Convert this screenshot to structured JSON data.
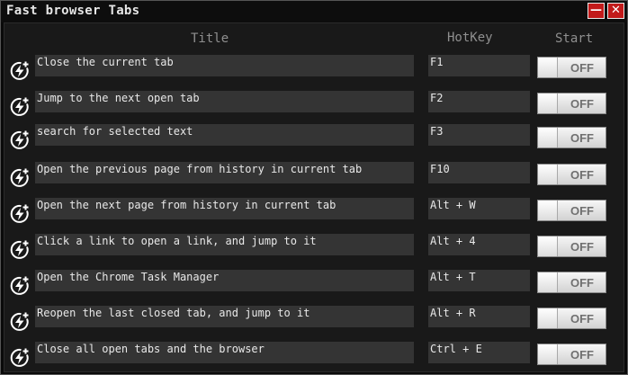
{
  "window": {
    "title": "Fast browser Tabs",
    "minimize_label": "—",
    "close_label": "✕"
  },
  "columns": {
    "title": "Title",
    "hotkey": "HotKey",
    "start": "Start"
  },
  "row_icon": "lightning-bolt-plus-icon",
  "rows": [
    {
      "task": "Close the current tab",
      "hotkey": "F1",
      "state": "OFF"
    },
    {
      "task": "Jump to the next open tab",
      "hotkey": "F2",
      "state": "OFF"
    },
    {
      "task": "search for selected text",
      "hotkey": "F3",
      "state": "OFF"
    },
    {
      "task": "Open the previous page from history in current tab",
      "hotkey": "F10",
      "state": "OFF"
    },
    {
      "task": "Open the next page from history in current tab",
      "hotkey": "Alt + W",
      "state": "OFF"
    },
    {
      "task": "Click a link to open a link, and jump to it",
      "hotkey": "Alt + 4",
      "state": "OFF"
    },
    {
      "task": "Open the Chrome Task Manager",
      "hotkey": "Alt + T",
      "state": "OFF"
    },
    {
      "task": "Reopen the last closed tab, and jump to it",
      "hotkey": "Alt + R",
      "state": "OFF"
    },
    {
      "task": "Close all open tabs and the browser",
      "hotkey": "Ctrl + E",
      "state": "OFF"
    }
  ]
}
